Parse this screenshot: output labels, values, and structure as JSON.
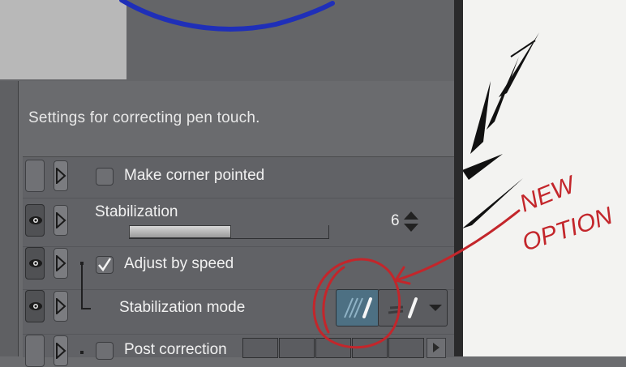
{
  "panel": {
    "description": "Settings for correcting pen touch."
  },
  "rows": {
    "corner": {
      "label": "Make corner pointed",
      "checked": false,
      "eye_visible": false
    },
    "stabilization": {
      "label": "Stabilization",
      "value": "6",
      "slider_fraction": 0.5,
      "eye_visible": true
    },
    "adjust": {
      "label": "Adjust by speed",
      "checked": true,
      "eye_visible": true
    },
    "mode": {
      "label": "Stabilization mode",
      "eye_visible": true
    },
    "post": {
      "label": "Post correction",
      "checked": false,
      "eye_visible": false
    }
  },
  "annotation": {
    "line1": "NEW",
    "line2": "OPTION",
    "color": "#c3262b"
  },
  "colors": {
    "stroke_blue": "#1f2fb8",
    "mode_selected": "#4d7083"
  },
  "icons": [
    "eye-icon",
    "expand-triangle-icon",
    "spin-up-icon",
    "spin-down-icon",
    "pen-mode-icon",
    "dropdown-arrow-icon"
  ]
}
